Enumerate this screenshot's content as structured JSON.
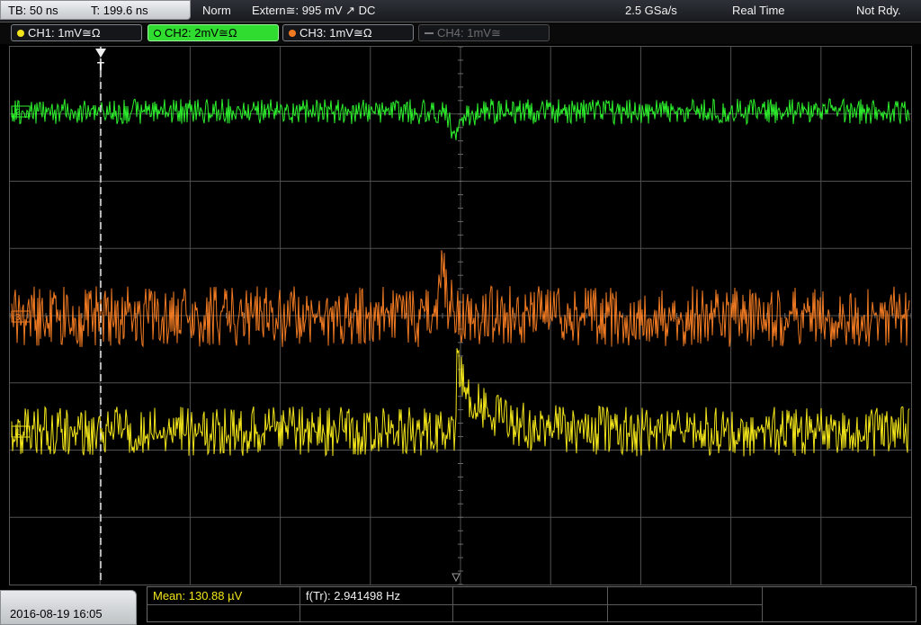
{
  "status": {
    "timebase": "TB: 50 ns",
    "trigger_time": "T: 199.6 ns",
    "mode": "Norm",
    "trigger_source": "Extern≅: 995 mV ↗ DC",
    "sample_rate": "2.5 GSa/s",
    "acquisition": "Real Time",
    "state": "Not Rdy."
  },
  "channels": [
    {
      "label": "CH1: 1mV≅Ω",
      "color": "#f2e51a",
      "active": false,
      "enabled": true
    },
    {
      "label": "CH2: 2mV≅Ω",
      "color": "#30f030",
      "active": true,
      "enabled": true
    },
    {
      "label": "CH3: 1mV≅Ω",
      "color": "#f07a22",
      "active": false,
      "enabled": true
    },
    {
      "label": "CH4: 1mV≅",
      "color": "#7a7a7a",
      "active": false,
      "enabled": false
    }
  ],
  "markers": {
    "ch1": "1",
    "ch2": "2",
    "ch3": "3",
    "trigger": "T"
  },
  "colors": {
    "ch1": "#f2e51a",
    "ch2": "#2cf02c",
    "ch3": "#f07a22",
    "grid": "#505050",
    "mean_label": "#f2e51a"
  },
  "footer": {
    "datetime": "2016-08-19 16:05",
    "mean_label": "Mean: 130.88 µV",
    "freq_label": "f(Tr): 2.941498 Hz"
  }
}
